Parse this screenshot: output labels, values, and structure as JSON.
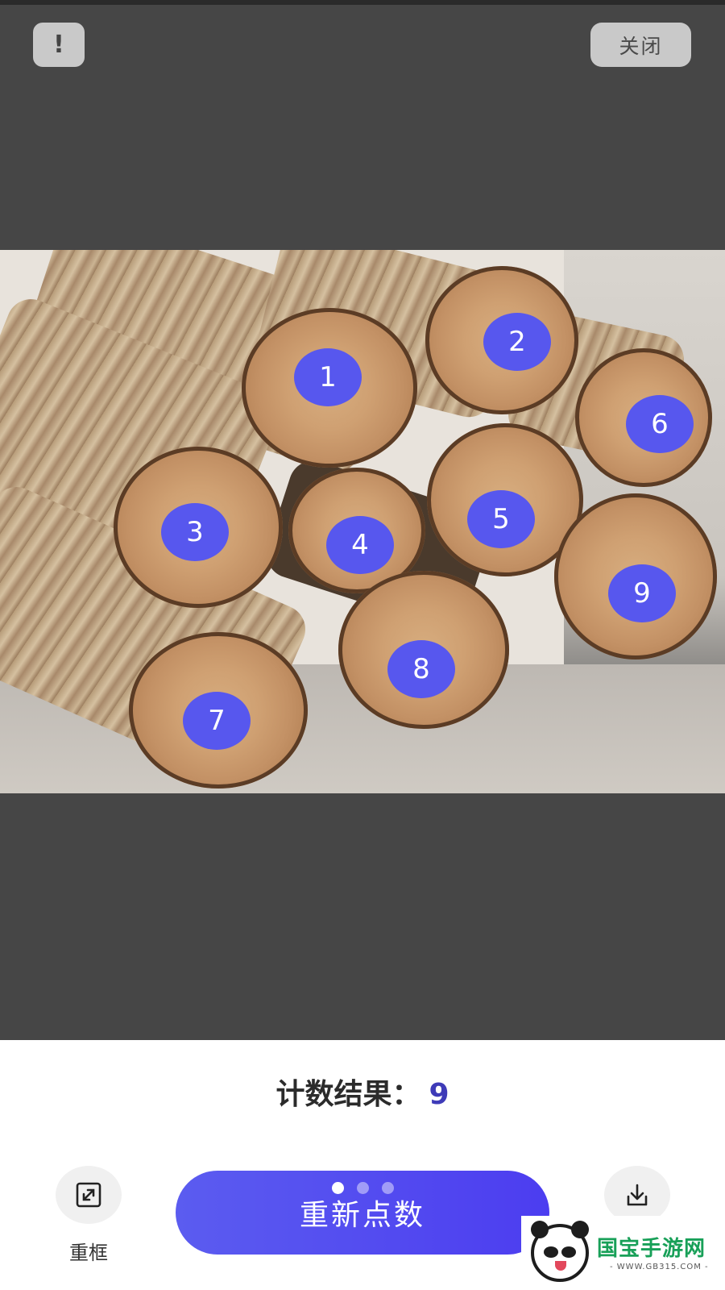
{
  "header": {
    "info_label": "!",
    "close_label": "关闭"
  },
  "photo": {
    "markers": [
      "1",
      "2",
      "3",
      "4",
      "5",
      "6",
      "7",
      "8",
      "9"
    ]
  },
  "result": {
    "label": "计数结果：",
    "count": "9"
  },
  "actions": {
    "reframe_label": "重框",
    "recount_label": "重新点数",
    "pager_dots": 3,
    "pager_active": 0
  },
  "watermark": {
    "title": "国宝手游网",
    "url": "- WWW.GB315.COM -"
  },
  "colors": {
    "accent": "#5757ee",
    "count": "#3e3bb8",
    "watermark": "#18a058"
  }
}
